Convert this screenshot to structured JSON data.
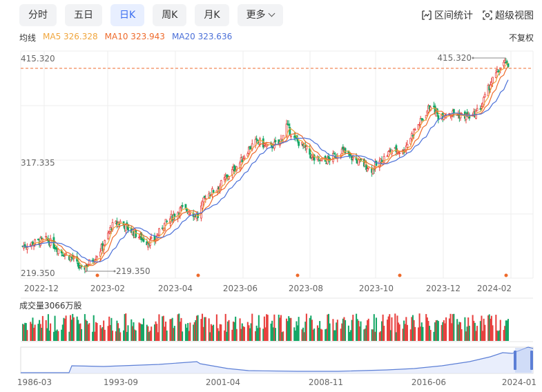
{
  "tabs": [
    {
      "label": "分时",
      "active": false
    },
    {
      "label": "五日",
      "active": false
    },
    {
      "label": "日K",
      "active": true
    },
    {
      "label": "周K",
      "active": false
    },
    {
      "label": "月K",
      "active": false
    },
    {
      "label": "更多",
      "active": false
    }
  ],
  "tools": {
    "range_stats": "区间统计",
    "super_view": "超级视图"
  },
  "ma": {
    "title": "均线",
    "ma5": "MA5 326.328",
    "ma10": "MA10 323.943",
    "ma20": "MA20 323.636"
  },
  "adjust_label": "不复权",
  "volume_label": "成交量3066万股",
  "colors": {
    "up": "#e8403e",
    "down": "#14a766",
    "ma5": "#f0a53c",
    "ma10": "#ee6a2b",
    "ma20": "#4a6fd8",
    "accent": "#3a6df0"
  },
  "chart_data": {
    "type": "candlestick",
    "y_axis_labels": [
      "415.320",
      "317.335",
      "219.350"
    ],
    "ylim": [
      219.35,
      415.32
    ],
    "x_axis_labels": [
      "2022-12",
      "2023-02",
      "2023-04",
      "2023-06",
      "2023-08",
      "2023-10",
      "2023-12",
      "2024-02"
    ],
    "high_marker": "415.320",
    "low_marker": "219.350",
    "close_path": [
      [
        "2022-11-28",
        244
      ],
      [
        "2022-12-08",
        247
      ],
      [
        "2022-12-20",
        250
      ],
      [
        "2023-01-03",
        238
      ],
      [
        "2023-01-12",
        233
      ],
      [
        "2023-01-20",
        222
      ],
      [
        "2023-02-03",
        236
      ],
      [
        "2023-02-10",
        247
      ],
      [
        "2023-02-16",
        262
      ],
      [
        "2023-02-24",
        266
      ],
      [
        "2023-03-03",
        260
      ],
      [
        "2023-03-10",
        255
      ],
      [
        "2023-03-20",
        248
      ],
      [
        "2023-03-27",
        249
      ],
      [
        "2023-04-03",
        262
      ],
      [
        "2023-04-12",
        271
      ],
      [
        "2023-04-20",
        278
      ],
      [
        "2023-04-28",
        276
      ],
      [
        "2023-05-05",
        271
      ],
      [
        "2023-05-12",
        290
      ],
      [
        "2023-05-22",
        296
      ],
      [
        "2023-06-02",
        309
      ],
      [
        "2023-06-12",
        320
      ],
      [
        "2023-06-20",
        333
      ],
      [
        "2023-06-28",
        340
      ],
      [
        "2023-07-07",
        334
      ],
      [
        "2023-07-18",
        338
      ],
      [
        "2023-07-24",
        354
      ],
      [
        "2023-07-31",
        342
      ],
      [
        "2023-08-09",
        334
      ],
      [
        "2023-08-18",
        323
      ],
      [
        "2023-08-28",
        321
      ],
      [
        "2023-09-05",
        326
      ],
      [
        "2023-09-12",
        331
      ],
      [
        "2023-09-20",
        325
      ],
      [
        "2023-10-09",
        314
      ],
      [
        "2023-10-18",
        322
      ],
      [
        "2023-10-27",
        332
      ],
      [
        "2023-11-06",
        330
      ],
      [
        "2023-11-16",
        349
      ],
      [
        "2023-11-24",
        360
      ],
      [
        "2023-12-01",
        373
      ],
      [
        "2023-12-08",
        362
      ],
      [
        "2023-12-18",
        366
      ],
      [
        "2023-12-28",
        363
      ],
      [
        "2024-01-08",
        362
      ],
      [
        "2024-01-16",
        372
      ],
      [
        "2024-01-24",
        392
      ],
      [
        "2024-02-01",
        405
      ],
      [
        "2024-02-07",
        412
      ],
      [
        "2024-02-09",
        405
      ]
    ],
    "ma_values_last": {
      "MA5": 326.328,
      "MA10": 323.943,
      "MA20": 323.636
    },
    "overview": {
      "type": "area",
      "x_axis_labels": [
        "1986-03",
        "1993-09",
        "2001-04",
        "2008-11",
        "2016-06",
        "2024-01"
      ]
    }
  }
}
